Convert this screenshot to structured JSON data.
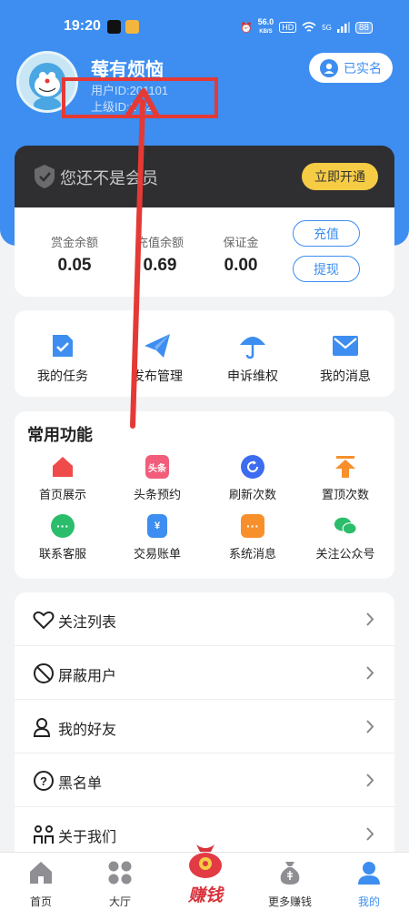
{
  "status_bar": {
    "time": "19:20",
    "net_speed_value": "56.0",
    "net_speed_unit": "KB/S",
    "hd": "HD",
    "signal": "5G",
    "battery": "88"
  },
  "user": {
    "name": "莓有烦恼",
    "id_line": "用户ID:201101",
    "parent_line": "上级ID:1  52"
  },
  "verify_button": "已实名",
  "membership": {
    "text": "您还不是会员",
    "button": "立即开通"
  },
  "balances": [
    {
      "label": "赏金余额",
      "value": "0.05"
    },
    {
      "label": "充值余额",
      "value": "0.69"
    },
    {
      "label": "保证金",
      "value": "0.00"
    }
  ],
  "balance_actions": {
    "recharge": "充值",
    "withdraw": "提现"
  },
  "quick_actions": [
    {
      "label": "我的任务",
      "icon": "task-icon"
    },
    {
      "label": "发布管理",
      "icon": "paper-plane-icon"
    },
    {
      "label": "申诉维权",
      "icon": "umbrella-icon"
    },
    {
      "label": "我的消息",
      "icon": "mail-icon"
    }
  ],
  "common_functions": {
    "title": "常用功能",
    "items": [
      {
        "label": "首页展示",
        "icon": "home-icon",
        "color": "#ef4b4b",
        "glyph": ""
      },
      {
        "label": "头条预约",
        "icon": "toutiao-icon",
        "color": "#f25d7a",
        "glyph": "头条"
      },
      {
        "label": "刷新次数",
        "icon": "refresh-icon",
        "color": "#3d6cf0",
        "glyph": ""
      },
      {
        "label": "置顶次数",
        "icon": "pin-top-icon",
        "color": "#f7902b",
        "glyph": ""
      },
      {
        "label": "联系客服",
        "icon": "chat-icon",
        "color": "#2bbd6b",
        "glyph": ""
      },
      {
        "label": "交易账单",
        "icon": "bill-icon",
        "color": "#3d8ef0",
        "glyph": "¥"
      },
      {
        "label": "系统消息",
        "icon": "message-icon",
        "color": "#f7902b",
        "glyph": ""
      },
      {
        "label": "关注公众号",
        "icon": "wechat-icon",
        "color": "#2bbd6b",
        "glyph": ""
      }
    ]
  },
  "menu_list": [
    {
      "label": "关注列表",
      "icon": "heart-icon"
    },
    {
      "label": "屏蔽用户",
      "icon": "block-icon"
    },
    {
      "label": "我的好友",
      "icon": "friends-icon"
    },
    {
      "label": "黑名单",
      "icon": "question-icon"
    },
    {
      "label": "关于我们",
      "icon": "about-icon"
    }
  ],
  "tabbar": {
    "items": [
      {
        "label": "首页",
        "icon": "home-tab-icon"
      },
      {
        "label": "大厅",
        "icon": "grid-icon"
      },
      {
        "label": "更多赚钱",
        "icon": "money-bag-icon"
      },
      {
        "label": "我的",
        "icon": "person-icon"
      }
    ],
    "center_label": "赚钱"
  },
  "colors": {
    "primary": "#3d8ef0",
    "member_bg": "#2f2f32",
    "member_button": "#f6cc45",
    "annotation": "#e53935"
  }
}
